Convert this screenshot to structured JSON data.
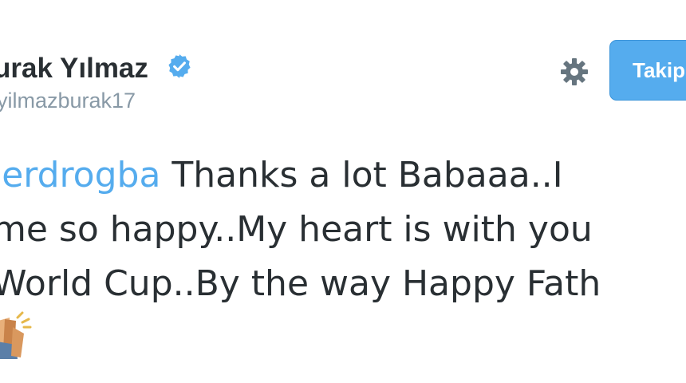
{
  "profile": {
    "display_name": "urak Yılmaz",
    "username": "yilmazburak17"
  },
  "actions": {
    "follow_label": "Takip",
    "settings_icon": "gear-icon",
    "verified_icon": "verified-badge-icon"
  },
  "tweet": {
    "mention": "ierdrogba",
    "line1_rest": " Thanks a lot Babaaa..I",
    "line2": "me so happy..My heart is with you",
    "line3": "World Cup..By the way Happy Fath",
    "emoji": "clapping-hands-icon"
  },
  "colors": {
    "accent": "#55acee",
    "text": "#292f33",
    "muted": "#8899a6"
  }
}
